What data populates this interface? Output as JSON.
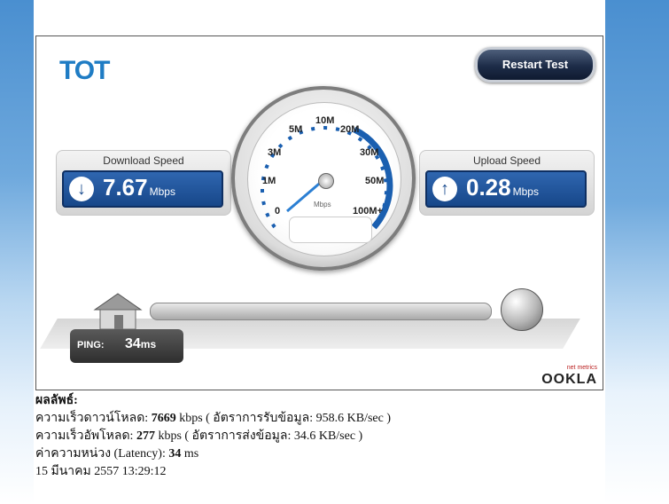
{
  "widget": {
    "logo_text": "TOT",
    "restart_label": "Restart Test",
    "download": {
      "title": "Download Speed",
      "value": "7.67",
      "unit": "Mbps"
    },
    "upload": {
      "title": "Upload Speed",
      "value": "0.28",
      "unit": "Mbps"
    },
    "gauge": {
      "labels": [
        "0",
        "1M",
        "3M",
        "5M",
        "10M",
        "20M",
        "30M",
        "50M",
        "100M+"
      ],
      "unit": "Mbps"
    },
    "ping": {
      "label": "PING:",
      "value": "34",
      "unit": "ms"
    },
    "brand": {
      "name": "OOKLA",
      "tagline": "net metrics"
    }
  },
  "results": {
    "header": "ผลลัพธ์:",
    "download_prefix": "ความเร็วดาวน์โหลด:",
    "download_kbps": "7669",
    "download_suffix": "kbps ( อัตราการรับข้อมูล: 958.6 KB/sec )",
    "upload_prefix": "ความเร็วอัพโหลด:",
    "upload_kbps": "277",
    "upload_suffix": "kbps ( อัตราการส่งข้อมูล: 34.6 KB/sec )",
    "latency_prefix": "ค่าความหน่วง (Latency):",
    "latency_value": "34",
    "latency_suffix": "ms",
    "datetime": "15 มีนาคม 2557 13:29:12"
  },
  "colors": {
    "accent": "#1f7cc4",
    "panel_blue": "#174789"
  }
}
